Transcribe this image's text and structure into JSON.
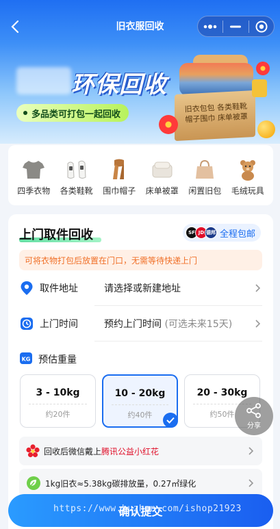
{
  "nav": {
    "title": "旧衣服回收"
  },
  "hero": {
    "title": "环保回收",
    "tagline": "多品类可打包一起回收",
    "box_text_line1": "旧衣包包  各类鞋靴",
    "box_text_line2": "帽子围巾  床单被罩"
  },
  "categories": [
    {
      "label": "四季衣物",
      "icon": "tshirt-icon"
    },
    {
      "label": "各类鞋靴",
      "icon": "shoes-icon"
    },
    {
      "label": "围巾帽子",
      "icon": "scarf-icon"
    },
    {
      "label": "床单被罩",
      "icon": "bedding-icon"
    },
    {
      "label": "闲置旧包",
      "icon": "bag-icon"
    },
    {
      "label": "毛绒玩具",
      "icon": "teddy-bear-icon"
    }
  ],
  "pickup": {
    "title": "上门取件回收",
    "courier_text": "全程包邮",
    "courier_logos": [
      "SF",
      "JD",
      "德邦"
    ],
    "tip": "可将衣物打包后放置在门口，无需等待快递上门",
    "address_label": "取件地址",
    "address_value": "请选择或新建地址",
    "time_label": "上门时间",
    "time_value": "预约上门时间",
    "time_hint": "(可选未来15天)",
    "weight_label": "预估重量",
    "weights": [
      {
        "range": "3 - 10kg",
        "count": "约20件",
        "selected": false
      },
      {
        "range": "10 - 20kg",
        "count": "约40件",
        "selected": true
      },
      {
        "range": "20 - 30kg",
        "count": "约50件",
        "selected": false
      }
    ],
    "info1_prefix": "回收后微信戴上",
    "info1_highlight": "腾讯公益小红花",
    "info2": "1kg旧衣≈5.38kg碳排放量，0.27㎡绿化"
  },
  "share_label": "分享",
  "confirm_label": "确认提交",
  "watermark": "https://www.huzhan.com/ishop21923",
  "colors": {
    "primary": "#1a6df0",
    "tip_text": "#f07028",
    "highlight_red": "#e0102a"
  }
}
